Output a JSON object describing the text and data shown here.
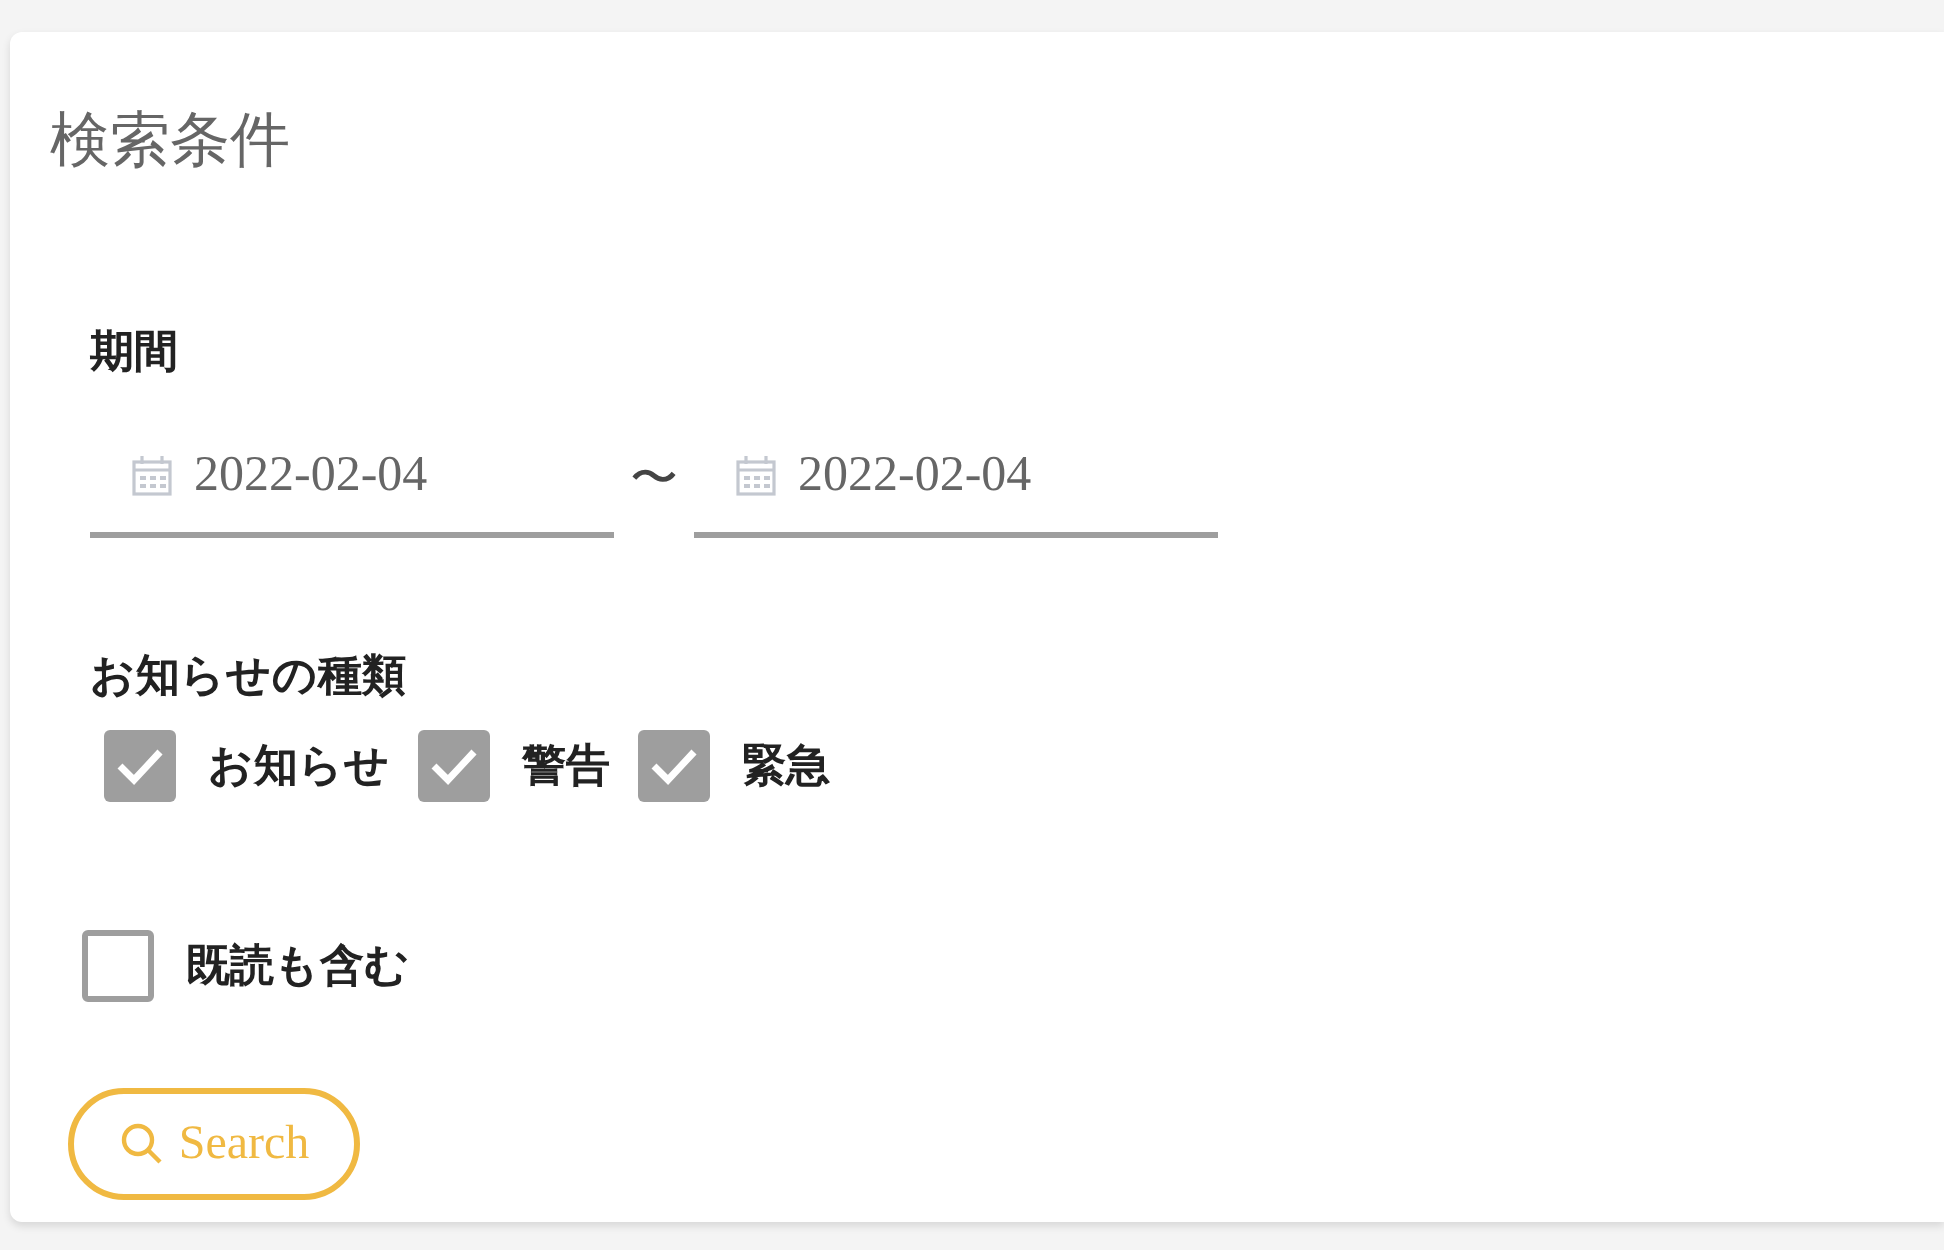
{
  "panel": {
    "title": "検索条件"
  },
  "period": {
    "label": "期間",
    "separator": "〜",
    "fields": [
      {
        "value": "2022-02-04"
      },
      {
        "value": "2022-02-04"
      }
    ]
  },
  "types": {
    "label": "お知らせの種類",
    "options": [
      {
        "label": "お知らせ",
        "checked": true
      },
      {
        "label": "警告",
        "checked": true
      },
      {
        "label": "緊急",
        "checked": true
      }
    ]
  },
  "include_read": {
    "label": "既読も含む",
    "checked": false
  },
  "search_button": {
    "label": "Search"
  }
}
